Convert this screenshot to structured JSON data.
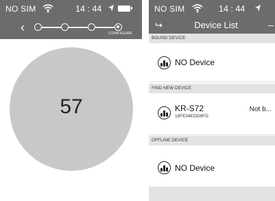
{
  "left_screen": {
    "status_bar": {
      "carrier": "NO SIM",
      "time": "14 : 44"
    },
    "stepper": {
      "current_label": "CONFIGURE"
    },
    "value_display": "57"
  },
  "right_screen": {
    "status_bar": {
      "carrier": "NO SIM",
      "time": "14 : 44"
    },
    "nav": {
      "title": "Device List"
    },
    "sections": {
      "bound": {
        "header": "BOUND DEVICE",
        "devices": [
          {
            "name": "NO Device"
          }
        ]
      },
      "find_new": {
        "header": "FIND NEW DEVICE",
        "devices": [
          {
            "name": "KR-S72",
            "id": "18FE34EDD6FD",
            "status": "Not b..."
          }
        ]
      },
      "offline": {
        "header": "OFFLINE DEVICE",
        "devices": [
          {
            "name": "NO Device"
          }
        ]
      }
    }
  },
  "colors": {
    "header_bg": "#6c6c6c",
    "section_bg": "#e3e3e3",
    "circle": "#c8c8c8"
  },
  "icons": [
    "wifi-icon",
    "location-arrow-icon",
    "battery-icon",
    "chevron-left-icon",
    "back-arrow-icon",
    "device-icon"
  ]
}
